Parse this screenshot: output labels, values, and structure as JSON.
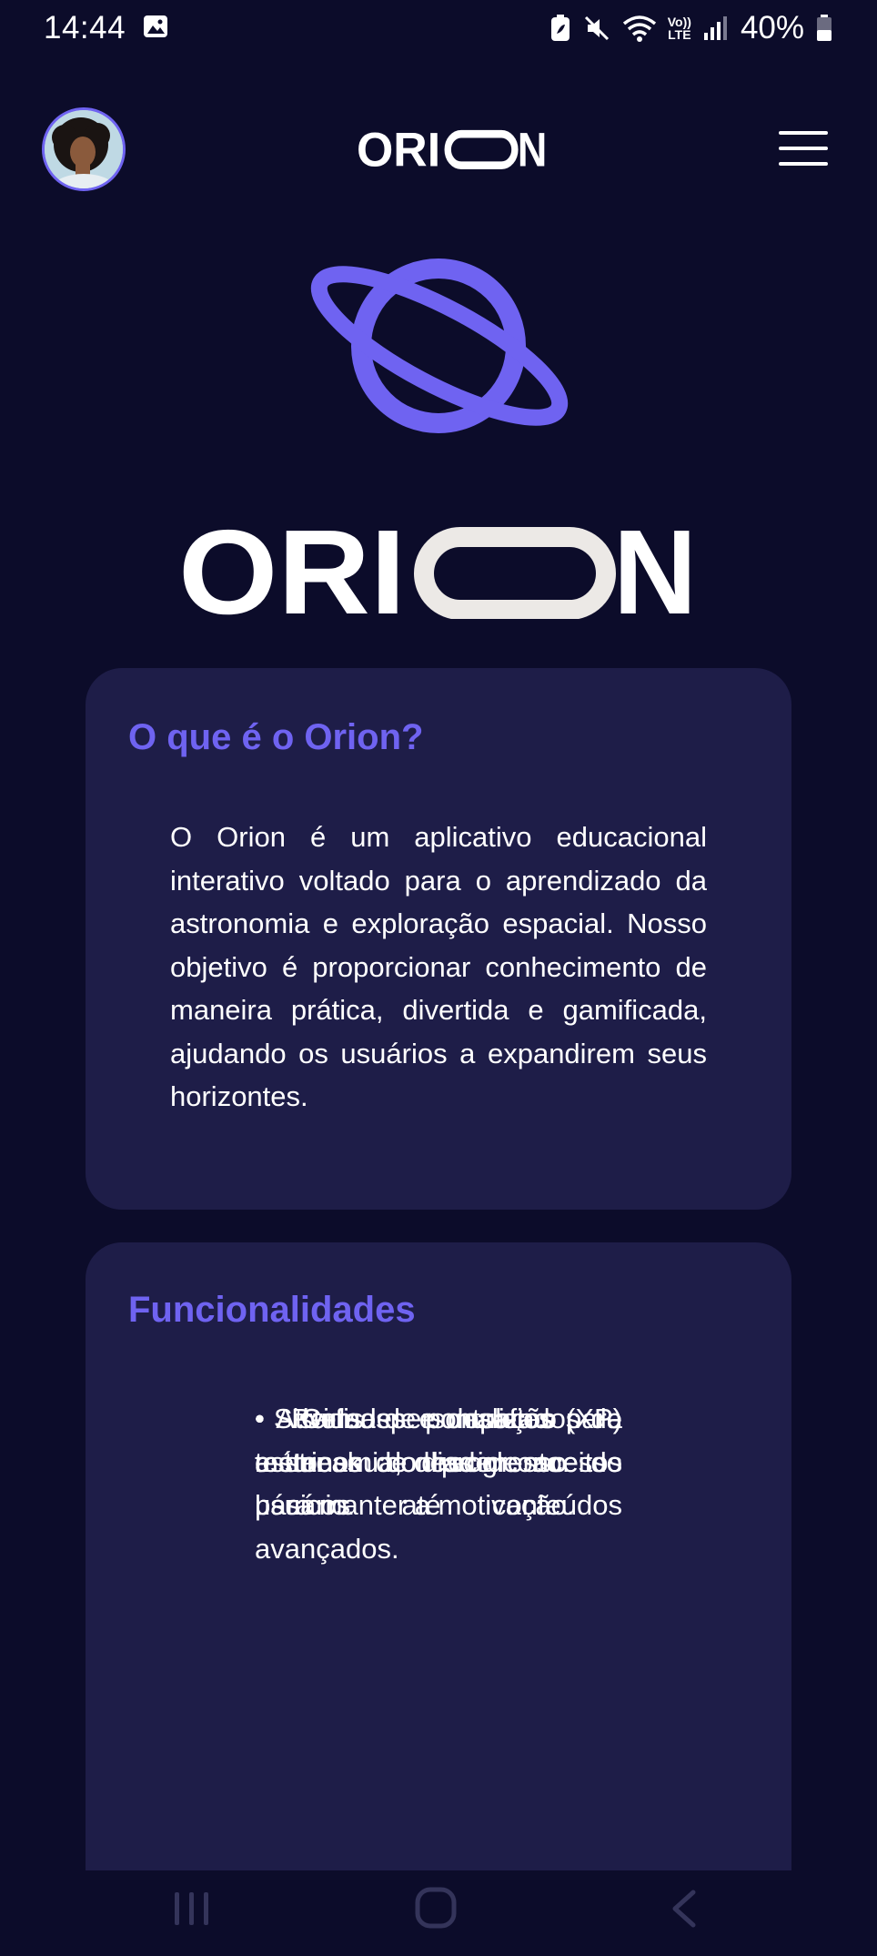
{
  "status_bar": {
    "time": "14:44",
    "battery": "40%",
    "icons": [
      "gallery-icon",
      "battery-saver-icon",
      "mute-icon",
      "wifi-icon",
      "volte-icon",
      "signal-icon",
      "battery-icon"
    ],
    "volte_label_top": "Vo))",
    "volte_label_bottom": "LTE"
  },
  "header": {
    "avatar": "user-avatar",
    "logo": "ORION",
    "menu": "hamburger-menu-icon"
  },
  "hero": {
    "icon": "planet-icon",
    "logo": "ORION"
  },
  "about": {
    "title": "O que é o Orion?",
    "body": "O Orion é um aplicativo educacional interativo voltado para o aprendizado da astronomia e exploração espacial. Nosso objetivo é proporcionar conhecimento de maneira prática, divertida e gamificada, ajudando os usuários a expandirem seus horizontes."
  },
  "features": {
    "title": "Funcionalidades",
    "items": [
      "• Cursos completos de astronomia, desde conceitos básicos até conteúdos avançados.",
      "• Atividades e desafios para testar seu conhecimento.",
      "• Sistema de pontuação (XP) e streak de dias de acesso para manter a motivação.",
      "• Perfis personalizados e métricas do progresso do usuário."
    ]
  },
  "colors": {
    "background": "#0c0c2a",
    "card": "#1e1d48",
    "accent": "#6f63f1",
    "text": "#ffffff"
  },
  "system_nav": [
    "recents-icon",
    "home-icon",
    "back-icon"
  ]
}
